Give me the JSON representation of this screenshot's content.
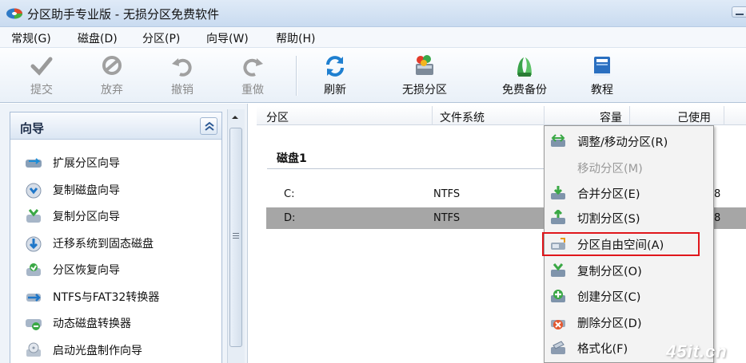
{
  "app": {
    "title": "分区助手专业版 - 无损分区免费软件"
  },
  "menu": [
    "常规(G)",
    "磁盘(D)",
    "分区(P)",
    "向导(W)",
    "帮助(H)"
  ],
  "toolbar": {
    "submit": "提交",
    "discard": "放弃",
    "undo": "撤销",
    "redo": "重做",
    "refresh": "刷新",
    "lossless": "无损分区",
    "backup": "免费备份",
    "tutorial": "教程"
  },
  "wizard": {
    "title": "向导",
    "items": [
      "扩展分区向导",
      "复制磁盘向导",
      "复制分区向导",
      "迁移系统到固态磁盘",
      "分区恢复向导",
      "NTFS与FAT32转换器",
      "动态磁盘转换器",
      "启动光盘制作向导"
    ]
  },
  "table": {
    "columns": [
      "分区",
      "文件系统",
      "容量",
      "己使用"
    ],
    "disk_label": "磁盘1",
    "rows": [
      {
        "partition": "C:",
        "fs": "NTFS",
        "tail": "8"
      },
      {
        "partition": "D:",
        "fs": "NTFS",
        "tail": "8"
      }
    ]
  },
  "context_menu": {
    "items": [
      "调整/移动分区(R)",
      "移动分区(M)",
      "合并分区(E)",
      "切割分区(S)",
      "分区自由空间(A)",
      "复制分区(O)",
      "创建分区(C)",
      "删除分区(D)",
      "格式化(F)"
    ]
  },
  "watermark": "45it.cn",
  "colors": {
    "accent": "#1a5fb4",
    "highlight": "#e0161b",
    "selected_row": "#a6a6a6"
  }
}
